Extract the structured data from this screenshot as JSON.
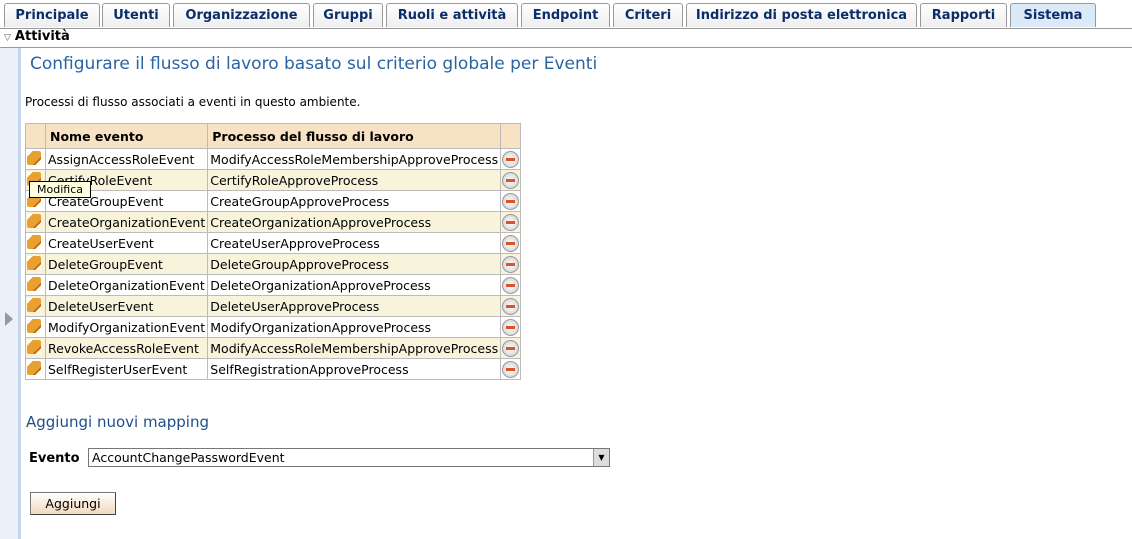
{
  "tabs": [
    "Principale",
    "Utenti",
    "Organizzazione",
    "Gruppi",
    "Ruoli e attività",
    "Endpoint",
    "Criteri",
    "Indirizzo di posta elettronica",
    "Rapporti",
    "Sistema"
  ],
  "active_tab": "Sistema",
  "section": "Attività",
  "title": "Configurare il flusso di lavoro basato sul criterio globale per Eventi",
  "description": "Processi di flusso associati a eventi in questo ambiente.",
  "table": {
    "headers": [
      "Nome evento",
      "Processo del flusso di lavoro"
    ],
    "rows": [
      [
        "AssignAccessRoleEvent",
        "ModifyAccessRoleMembershipApproveProcess"
      ],
      [
        "CertifyRoleEvent",
        "CertifyRoleApproveProcess"
      ],
      [
        "CreateGroupEvent",
        "CreateGroupApproveProcess"
      ],
      [
        "CreateOrganizationEvent",
        "CreateOrganizationApproveProcess"
      ],
      [
        "CreateUserEvent",
        "CreateUserApproveProcess"
      ],
      [
        "DeleteGroupEvent",
        "DeleteGroupApproveProcess"
      ],
      [
        "DeleteOrganizationEvent",
        "DeleteOrganizationApproveProcess"
      ],
      [
        "DeleteUserEvent",
        "DeleteUserApproveProcess"
      ],
      [
        "ModifyOrganizationEvent",
        "ModifyOrganizationApproveProcess"
      ],
      [
        "RevokeAccessRoleEvent",
        "ModifyAccessRoleMembershipApproveProcess"
      ],
      [
        "SelfRegisterUserEvent",
        "SelfRegistrationApproveProcess"
      ]
    ]
  },
  "tooltip": "Modifica",
  "add_section": {
    "title": "Aggiungi nuovi mapping",
    "event_label": "Evento",
    "event_value": "AccountChangePasswordEvent",
    "add_button": "Aggiungi"
  }
}
